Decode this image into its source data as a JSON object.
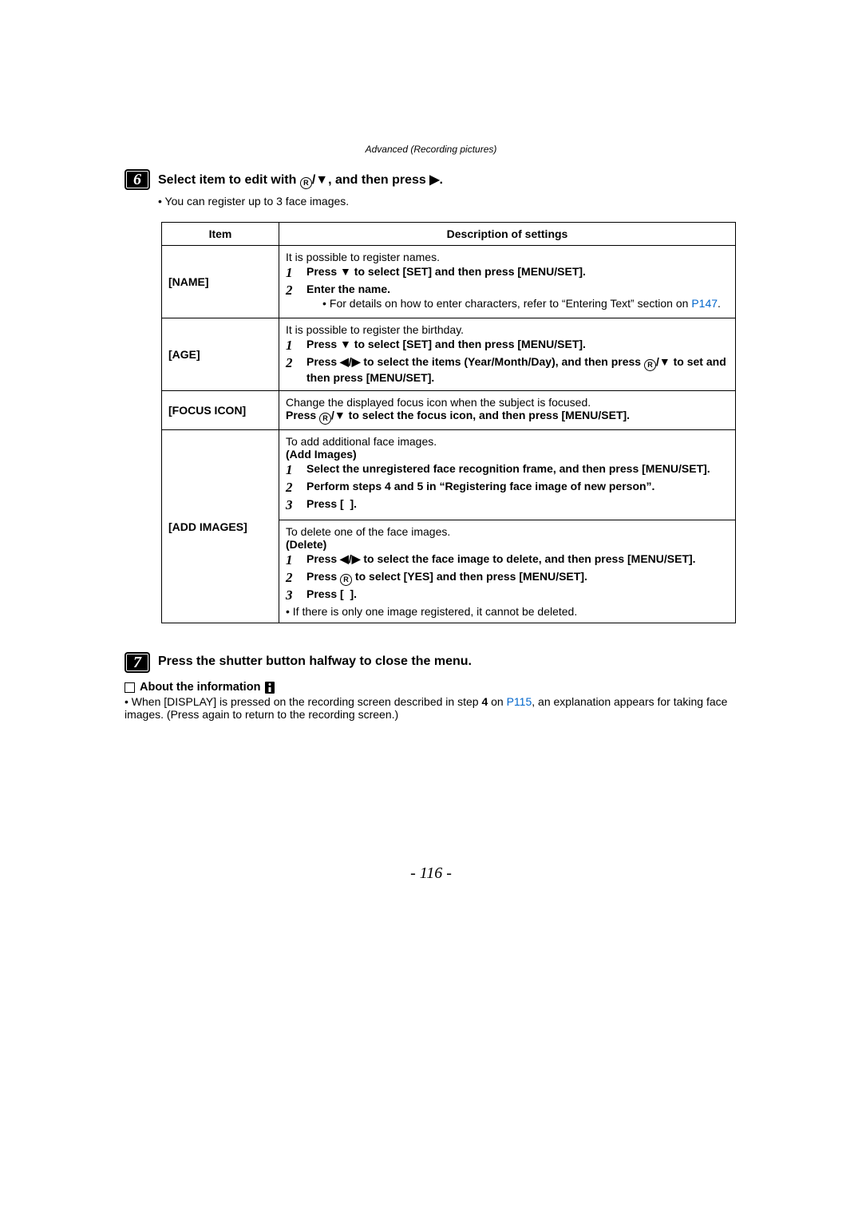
{
  "header": "Advanced (Recording pictures)",
  "step6": {
    "num": "6",
    "title_a": "Select item to edit with ",
    "title_b": ", and then press ",
    "title_c": ".",
    "bullet": "You can register up to 3 face images."
  },
  "table": {
    "head_item": "Item",
    "head_desc": "Description of settings",
    "name": {
      "label": "[NAME]",
      "intro": "It is possible to register names.",
      "s1": "Press ▼ to select [SET] and then press [MENU/SET].",
      "s2": "Enter the name.",
      "sub_a": "For details on how to enter characters, refer to “Entering Text” section on ",
      "sub_link": "P147",
      "sub_b": "."
    },
    "age": {
      "label": "[AGE]",
      "intro": "It is possible to register the birthday.",
      "s1": "Press ▼ to select [SET] and then press [MENU/SET].",
      "s2a": "Press ◀/▶ to select the items (Year/Month/Day), and then press ",
      "s2b": "/▼ to set and then press [MENU/SET]."
    },
    "focus": {
      "label": "[FOCUS ICON]",
      "intro": "Change the displayed focus icon when the subject is focused.",
      "line_a": "Press ",
      "line_b": "/▼ to select the focus icon, and then press [MENU/SET]."
    },
    "add": {
      "label": "[ADD IMAGES]",
      "top_intro": "To add additional face images.",
      "top_head": "(Add Images)",
      "a1": "Select the unregistered face recognition frame, and then press [MENU/SET].",
      "a2": "Perform steps 4 and 5 in “Registering face image of new person”.",
      "a3": "Press [  ].",
      "bot_intro": "To delete one of the face images.",
      "bot_head": "(Delete)",
      "d1": "Press ◀/▶ to select the face image to delete, and then press [MENU/SET].",
      "d2a": "Press ",
      "d2b": " to select [YES] and then press [MENU/SET].",
      "d3": "Press [  ].",
      "note": "If there is only one image registered, it cannot be deleted."
    }
  },
  "step7": {
    "num": "7",
    "title": "Press the shutter button halfway to close the menu."
  },
  "about": {
    "head": "About the information",
    "body_a": "When [DISPLAY] is pressed on the recording screen described in step ",
    "body_bold": "4",
    "body_b": " on ",
    "body_link": "P115",
    "body_c": ", an explanation appears for taking face images. (Press again to return to the recording screen.)"
  },
  "pagenum": "- 116 -"
}
